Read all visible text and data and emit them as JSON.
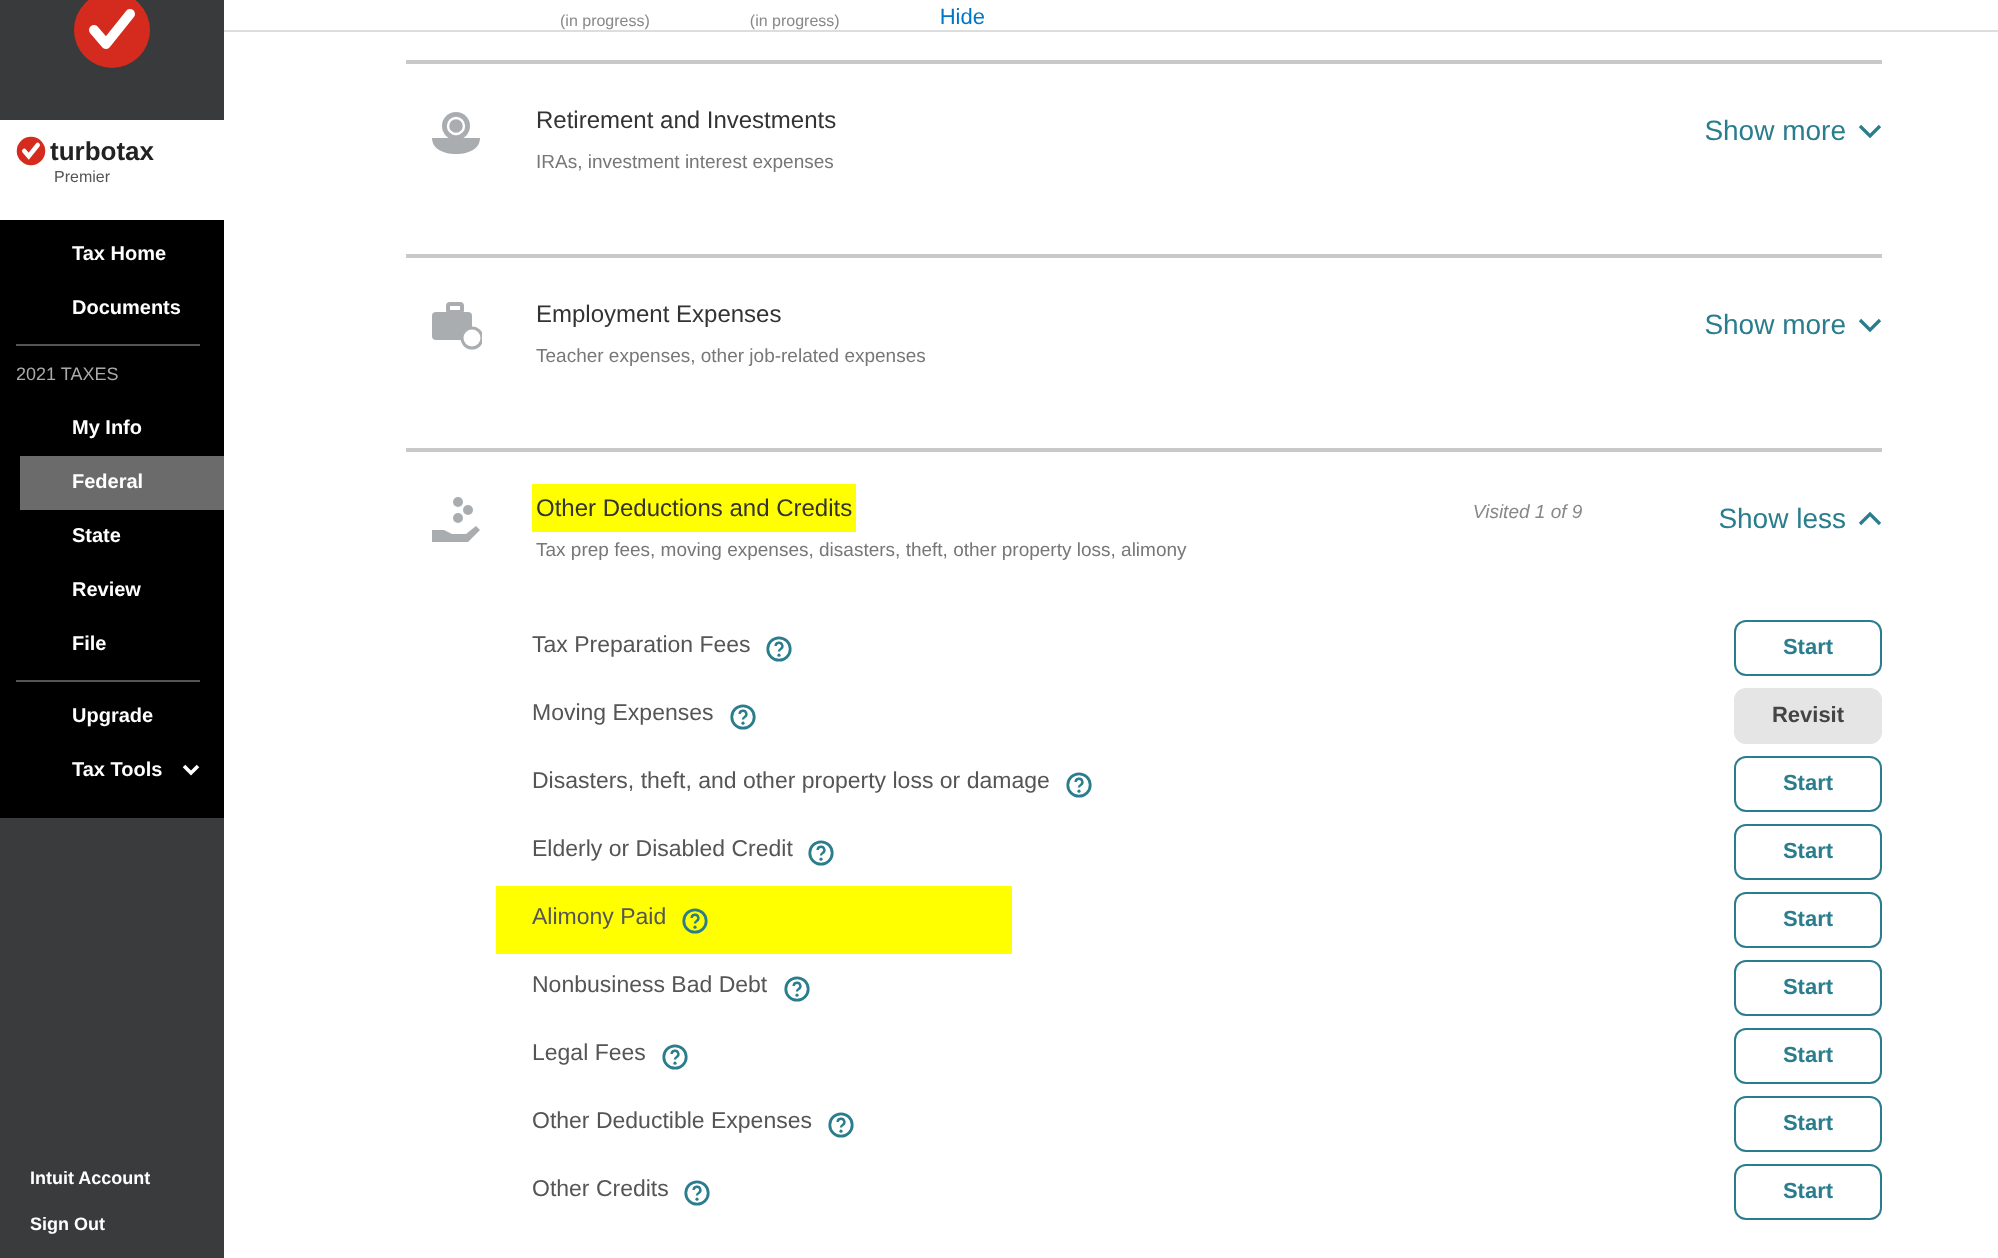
{
  "top_bar": {
    "items": [
      {
        "label": "(in progress)"
      },
      {
        "label": "(in progress)"
      }
    ],
    "hide_link": "Hide"
  },
  "sidebar": {
    "brand": "turbotax",
    "edition": "Premier",
    "items": [
      {
        "label": "Tax Home",
        "selected": false
      },
      {
        "label": "Documents",
        "selected": false
      }
    ],
    "section_label": "2021 TAXES",
    "tax_items": [
      {
        "label": "My Info",
        "selected": false
      },
      {
        "label": "Federal",
        "selected": true
      },
      {
        "label": "State",
        "selected": false
      },
      {
        "label": "Review",
        "selected": false
      },
      {
        "label": "File",
        "selected": false
      }
    ],
    "extra_items": [
      {
        "label": "Upgrade",
        "kind": "link"
      },
      {
        "label": "Tax Tools",
        "kind": "dropdown"
      }
    ],
    "footer_items": [
      "Intuit Account",
      "Sign Out"
    ]
  },
  "sections": [
    {
      "title": "Retirement and Investments",
      "subtitle": "IRAs, investment interest expenses",
      "highlighted": false,
      "expanded": false,
      "toggle": "Show more"
    },
    {
      "title": "Employment Expenses",
      "subtitle": "Teacher expenses, other job-related expenses",
      "highlighted": false,
      "expanded": false,
      "toggle": "Show more"
    },
    {
      "title": "Other Deductions and Credits",
      "subtitle": "Tax prep fees, moving expenses, disasters, theft, other property loss, alimony",
      "highlighted": true,
      "expanded": true,
      "visited": "Visited 1 of 9",
      "toggle": "Show less",
      "items": [
        {
          "label": "Tax Preparation Fees",
          "action": "Start",
          "kind": "start",
          "highlighted": false
        },
        {
          "label": "Moving Expenses",
          "action": "Revisit",
          "kind": "revisit",
          "highlighted": false
        },
        {
          "label": "Disasters, theft, and other property loss or damage",
          "action": "Start",
          "kind": "start",
          "highlighted": false
        },
        {
          "label": "Elderly or Disabled Credit",
          "action": "Start",
          "kind": "start",
          "highlighted": false
        },
        {
          "label": "Alimony Paid",
          "action": "Start",
          "kind": "start",
          "highlighted": true
        },
        {
          "label": "Nonbusiness Bad Debt",
          "action": "Start",
          "kind": "start",
          "highlighted": false
        },
        {
          "label": "Legal Fees",
          "action": "Start",
          "kind": "start",
          "highlighted": false
        },
        {
          "label": "Other Deductible Expenses",
          "action": "Start",
          "kind": "start",
          "highlighted": false
        },
        {
          "label": "Other Credits",
          "action": "Start",
          "kind": "start",
          "highlighted": false
        }
      ]
    }
  ]
}
